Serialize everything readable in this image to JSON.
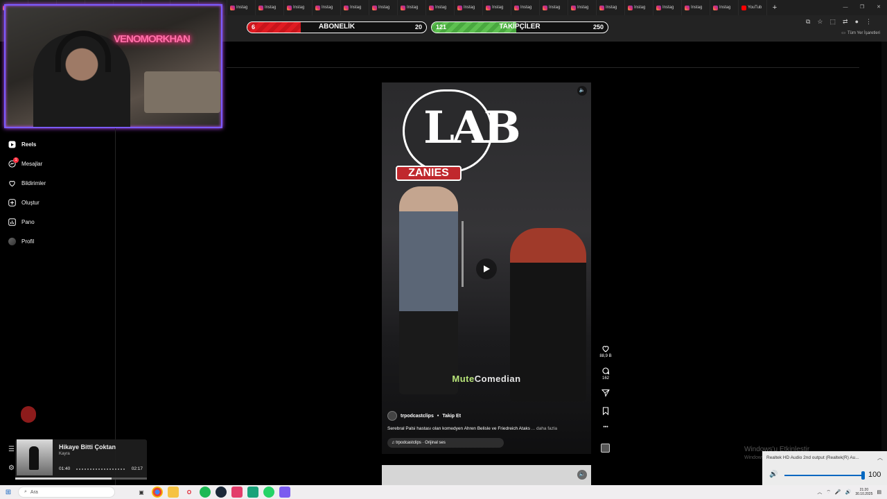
{
  "browser": {
    "tabs": [
      {
        "label": "Instag",
        "kind": "instagram"
      },
      {
        "label": "Instag",
        "kind": "instagram"
      },
      {
        "label": "Instag",
        "kind": "instagram"
      },
      {
        "label": "Instag",
        "kind": "instagram"
      },
      {
        "label": "Instag",
        "kind": "instagram"
      },
      {
        "label": "Instag",
        "kind": "instagram"
      },
      {
        "label": "Instag",
        "kind": "instagram"
      },
      {
        "label": "Instag",
        "kind": "instagram"
      },
      {
        "label": "Instag",
        "kind": "instagram"
      },
      {
        "label": "Instag",
        "kind": "instagram"
      },
      {
        "label": "Instag",
        "kind": "instagram"
      },
      {
        "label": "Instag",
        "kind": "instagram"
      },
      {
        "label": "Instag",
        "kind": "instagram"
      },
      {
        "label": "Instag",
        "kind": "instagram"
      },
      {
        "label": "Instag",
        "kind": "instagram"
      },
      {
        "label": "Instag",
        "kind": "instagram"
      },
      {
        "label": "Instag",
        "kind": "instagram"
      },
      {
        "label": "Instag",
        "kind": "instagram"
      },
      {
        "label": "Instag",
        "kind": "instagram"
      },
      {
        "label": "Instag",
        "kind": "instagram"
      },
      {
        "label": "Instag",
        "kind": "instagram"
      },
      {
        "label": "Instag",
        "kind": "instagram"
      },
      {
        "label": "Instag",
        "kind": "instagram"
      },
      {
        "label": "Instag",
        "kind": "instagram"
      },
      {
        "label": "Instag",
        "kind": "instagram"
      },
      {
        "label": "Instag",
        "kind": "instagram"
      },
      {
        "label": "YouTub",
        "kind": "youtube"
      }
    ],
    "new_tab": "+",
    "bookmarks_label": "Tüm Yer İşaretleri"
  },
  "overlay": {
    "subs": {
      "label": "ABONELİK",
      "current": "6",
      "goal": "20",
      "progress": 0.3,
      "color": "#e01b22"
    },
    "follows": {
      "label": "TAKİPÇİLER",
      "current": "121",
      "goal": "250",
      "progress": 0.48,
      "color": "#5ec151"
    },
    "neon_sign": "VENOMORKHAN"
  },
  "sidebar": {
    "items": [
      {
        "label": "Reels",
        "icon": "reels-icon"
      },
      {
        "label": "Mesajlar",
        "icon": "messenger-icon",
        "badge": "1"
      },
      {
        "label": "Bildirimler",
        "icon": "heart-icon"
      },
      {
        "label": "Oluştur",
        "icon": "plus-square-icon"
      },
      {
        "label": "Pano",
        "icon": "dashboard-icon"
      },
      {
        "label": "Profil",
        "icon": "avatar"
      }
    ]
  },
  "reel": {
    "author": "trpodcastclips",
    "separator": "•",
    "follow_label": "Takip Et",
    "caption": "Serebral Palsi hastası olan komedyen Ahren Belisle ve Friedreich Ataks",
    "more_label": "... daha fazla",
    "audio": "trpodcastclips · Orijinal ses",
    "watermark_a": "Mute",
    "watermark_b": "Comedian",
    "stage_sign": "LAB",
    "stage_sign2": "ZANIES",
    "likes": "88,9 B",
    "comments": "162",
    "more_icon": "•••"
  },
  "music": {
    "title": "Hikaye Bitti Çoktan",
    "artist": "Kayra",
    "elapsed": "01:40",
    "total": "02:17",
    "progress": 0.73
  },
  "system": {
    "activation": "Windows'u Etkinleştir",
    "activation_sub": "Windows'u etkinleştirmek için Ayarlar'a gidin.",
    "audio_device": "Realtek HD Audio 2nd output (Realtek(R) Au...",
    "volume": "100",
    "search_placeholder": "Ara",
    "time": "21:20",
    "date": "30.10.2025"
  }
}
